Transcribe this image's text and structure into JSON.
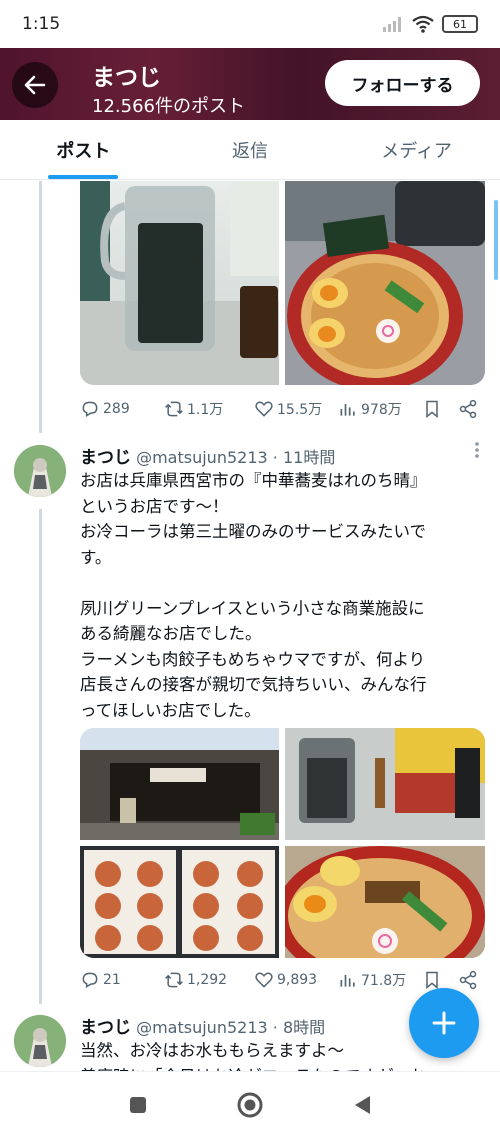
{
  "status_bar": {
    "time": "1:15",
    "battery": "61"
  },
  "header": {
    "name": "まつじ",
    "post_count": "12.566件のポスト",
    "follow_label": "フォローする"
  },
  "tabs": [
    {
      "label": "ポスト"
    },
    {
      "label": "返信"
    },
    {
      "label": "メディア"
    }
  ],
  "tweet_prev": {
    "stats": {
      "replies": "289",
      "retweets": "1.1万",
      "likes": "15.5万",
      "views": "978万"
    }
  },
  "tweet1": {
    "name": "まつじ",
    "handle": "@matsujun5213",
    "time": "· 11時間",
    "text": "お店は兵庫県西宮市の『中華蕎麦はれのち晴』\nというお店です～！\nお冷コーラは第三土曜のみのサービスみたいで\nす。\n\n夙川グリーンプレイスという小さな商業施設に\nある綺麗なお店でした。\nラーメンも肉餃子もめちゃウマですが、何より\n店長さんの接客が親切で気持ちいい、みんな行\nってほしいお店でした。",
    "stats": {
      "replies": "21",
      "retweets": "1,292",
      "likes": "9,893",
      "views": "71.8万"
    }
  },
  "tweet2": {
    "name": "まつじ",
    "handle": "@matsujun5213",
    "time": "· 8時間",
    "text": "当然、お冷はお水ももらえますよ～\n着席時に「今日はお冷がコーラなのですが、お"
  },
  "colors": {
    "accent": "#1d9bf0",
    "header_bg": "#6b1a3c",
    "secondary_text": "#536471"
  },
  "icons": [
    "back-arrow-icon",
    "reply-icon",
    "retweet-icon",
    "like-icon",
    "views-icon",
    "bookmark-icon",
    "share-icon",
    "plus-icon",
    "more-icon"
  ]
}
